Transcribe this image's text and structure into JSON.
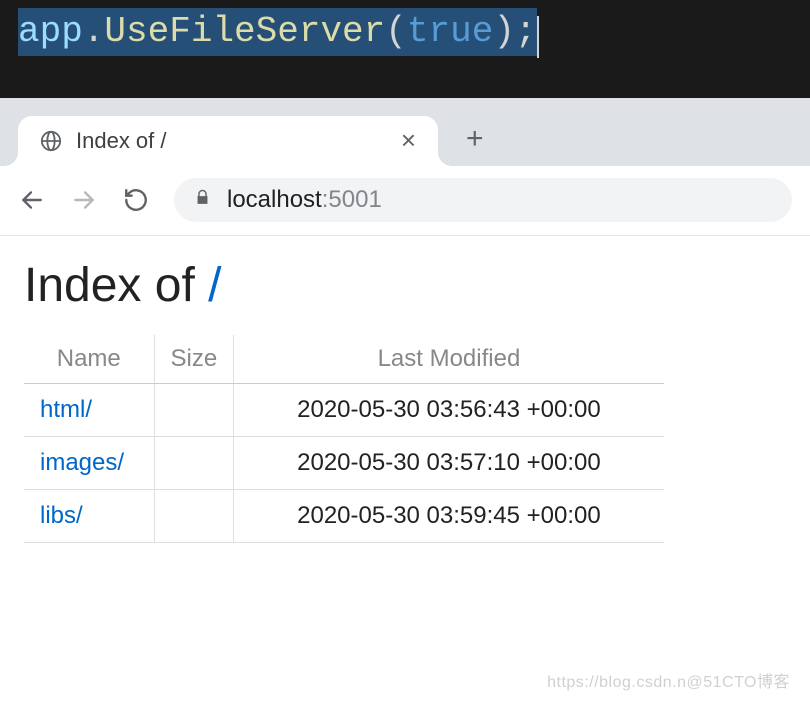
{
  "code": {
    "var": "app",
    "dot": ".",
    "method": "UseFileServer",
    "open": "(",
    "arg": "true",
    "close": ")",
    "semi": ";"
  },
  "browser": {
    "tab_title": "Index of /",
    "tab_close": "×",
    "newtab": "+",
    "address_host": "localhost",
    "address_port": ":5001"
  },
  "page": {
    "heading_prefix": "Index of ",
    "heading_path": "/",
    "columns": {
      "name": "Name",
      "size": "Size",
      "modified": "Last Modified"
    },
    "rows": [
      {
        "name": "html/",
        "size": "",
        "modified": "2020-05-30 03:56:43 +00:00"
      },
      {
        "name": "images/",
        "size": "",
        "modified": "2020-05-30 03:57:10 +00:00"
      },
      {
        "name": "libs/",
        "size": "",
        "modified": "2020-05-30 03:59:45 +00:00"
      }
    ]
  },
  "watermark": "https://blog.csdn.n@51CTO博客"
}
